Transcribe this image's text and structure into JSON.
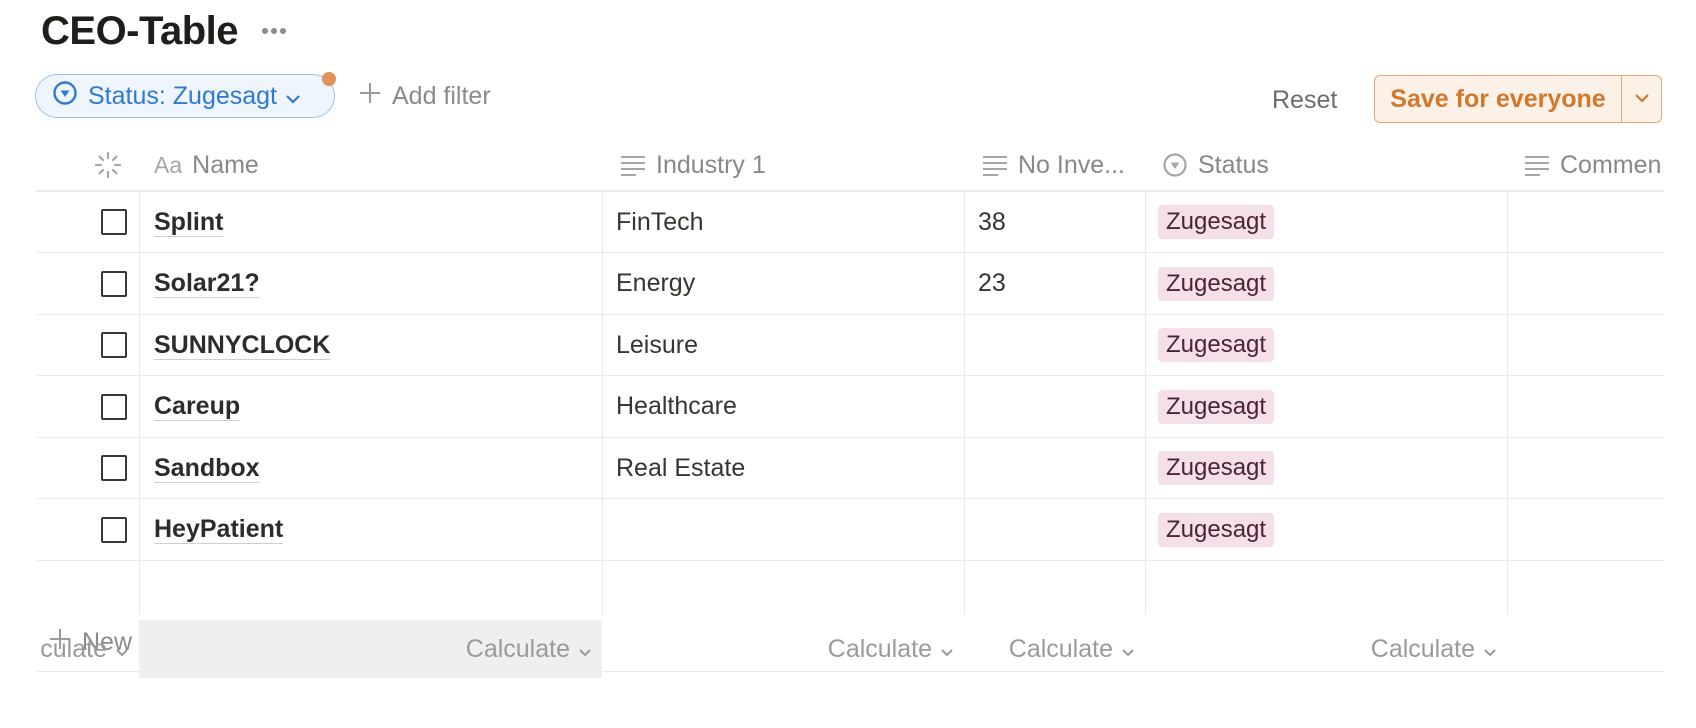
{
  "page": {
    "title": "CEO-Table",
    "more_icon": "ellipsis-icon"
  },
  "filter": {
    "label": "Status: Zugesagt",
    "icon": "status-circle-icon",
    "add_label": "Add filter"
  },
  "actions": {
    "reset_label": "Reset",
    "save_label": "Save for everyone"
  },
  "table": {
    "columns": [
      {
        "label": "",
        "icon": "loading-spinner-icon"
      },
      {
        "label": "Name",
        "icon": "title-aa-icon"
      },
      {
        "label": "Industry 1",
        "icon": "text-lines-icon"
      },
      {
        "label": "No Inve...",
        "icon": "text-lines-icon"
      },
      {
        "label": "Status",
        "icon": "status-circle-icon"
      },
      {
        "label": "Commen",
        "icon": "text-lines-icon"
      }
    ],
    "rows": [
      {
        "name": "Splint",
        "industry": "FinTech",
        "investors": "38",
        "status": "Zugesagt",
        "comment": ""
      },
      {
        "name": "Solar21?",
        "industry": "Energy",
        "investors": "23",
        "status": "Zugesagt",
        "comment": ""
      },
      {
        "name": "SUNNYCLOCK",
        "industry": "Leisure",
        "investors": "",
        "status": "Zugesagt",
        "comment": ""
      },
      {
        "name": "Careup",
        "industry": "Healthcare",
        "investors": "",
        "status": "Zugesagt",
        "comment": ""
      },
      {
        "name": "Sandbox",
        "industry": "Real Estate",
        "investors": "",
        "status": "Zugesagt",
        "comment": ""
      },
      {
        "name": "HeyPatient",
        "industry": "",
        "investors": "",
        "status": "Zugesagt",
        "comment": ""
      }
    ],
    "new_label": "New",
    "calc_first": "culate",
    "calc_label": "Calculate"
  },
  "colors": {
    "accent_blue": "#2f7ad0",
    "save_orange": "#d2782e",
    "status_tag_bg": "#f5e0e9",
    "filter_dot": "#e0935a"
  }
}
